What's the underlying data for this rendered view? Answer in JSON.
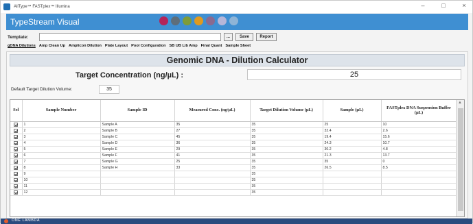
{
  "window": {
    "title": "AllType™ FASTplex™ Illumina",
    "controls": [
      "–",
      "□",
      "×"
    ]
  },
  "header": {
    "app_name": "TypeStream Visual",
    "dots": [
      {
        "color": "#b3245a"
      },
      {
        "color": "#5e6e7a"
      },
      {
        "color": "#7e9c3a"
      },
      {
        "color": "#e09a1f"
      },
      {
        "color": "#8a6a90"
      },
      {
        "color": "#b6b6d8"
      },
      {
        "color": "#8fb4d6"
      }
    ]
  },
  "template": {
    "label": "Template:",
    "value": "",
    "browse_label": "...",
    "save_label": "Save",
    "report_label": "Report"
  },
  "tabs": [
    {
      "label": "gDNA Dilutions",
      "active": true
    },
    {
      "label": "Amp Clean Up"
    },
    {
      "label": "Amplicon Dilution"
    },
    {
      "label": "Plate Layout"
    },
    {
      "label": "Pool Configuration"
    },
    {
      "label": "SB UB Lib Amp"
    },
    {
      "label": "Final Quant"
    },
    {
      "label": "Sample Sheet"
    }
  ],
  "calculator": {
    "title": "Genomic DNA - Dilution Calculator",
    "target_conc_label": "Target Concentration (ng/µL) :",
    "target_conc_value": "25",
    "default_volume_label": "Default Target Dilution Volume:",
    "default_volume_value": "35"
  },
  "table": {
    "columns": [
      "Sel",
      "Sample Number",
      "Sample ID",
      "Measured Conc. (ng/µL)",
      "Target Dilution Volume (µL)",
      "Sample (µL)",
      "FASTplex DNA Suspension Buffer (µL)"
    ],
    "rows": [
      [
        "1",
        "Sample A",
        "35",
        "35",
        "25",
        "10"
      ],
      [
        "2",
        "Sample B",
        "27",
        "35",
        "32.4",
        "2.6"
      ],
      [
        "3",
        "Sample C",
        "45",
        "35",
        "19.4",
        "15.6"
      ],
      [
        "4",
        "Sample D",
        "36",
        "35",
        "24.3",
        "10.7"
      ],
      [
        "5",
        "Sample E",
        "29",
        "35",
        "30.2",
        "4.8"
      ],
      [
        "6",
        "Sample F",
        "41",
        "35",
        "21.3",
        "13.7"
      ],
      [
        "7",
        "Sample G",
        "25",
        "35",
        "35",
        "0"
      ],
      [
        "8",
        "Sample H",
        "33",
        "35",
        "26.5",
        "8.5"
      ],
      [
        "9",
        "",
        "",
        "35",
        "",
        ""
      ],
      [
        "10",
        "",
        "",
        "35",
        "",
        ""
      ],
      [
        "11",
        "",
        "",
        "35",
        "",
        ""
      ],
      [
        "12",
        "",
        "",
        "35",
        "",
        ""
      ]
    ]
  },
  "footer": {
    "text": "ONE LAMBDA"
  }
}
